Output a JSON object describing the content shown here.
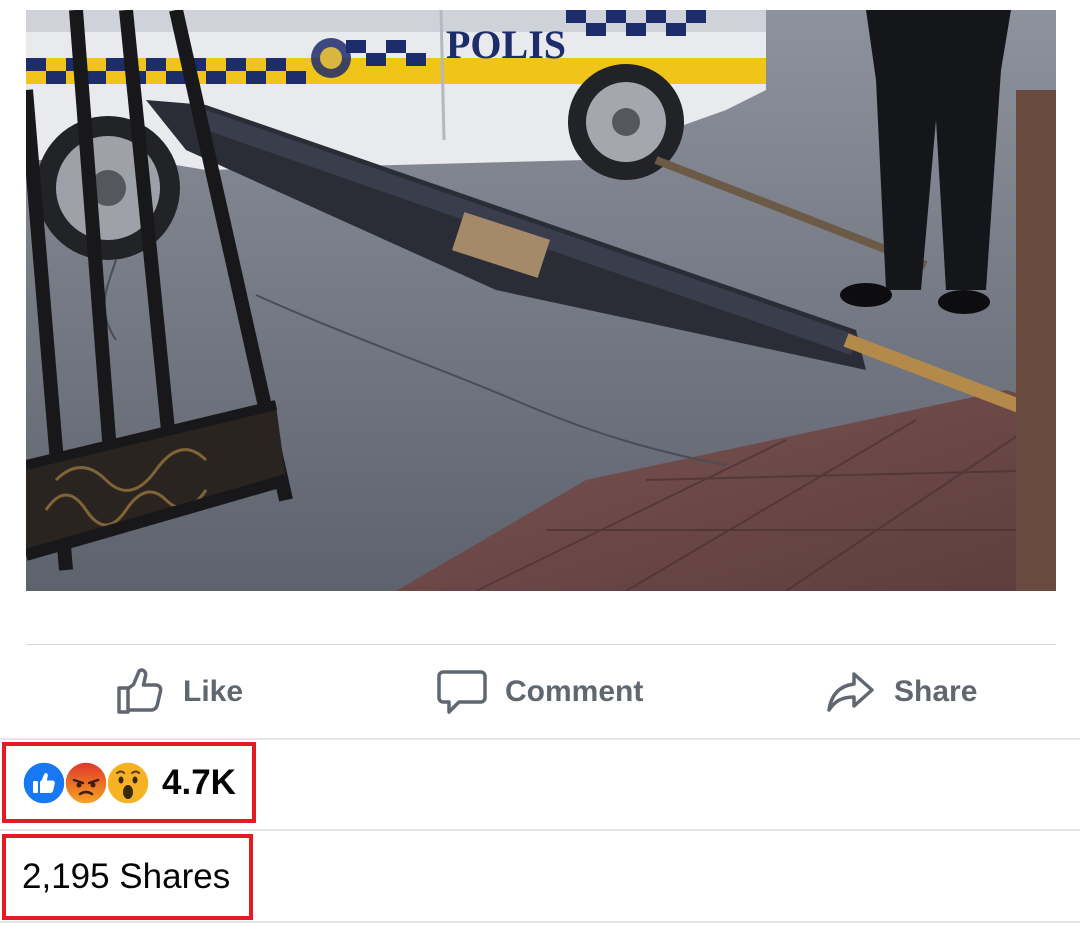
{
  "post": {
    "photo": {
      "car_label": "POLIS"
    }
  },
  "actions": {
    "like_label": "Like",
    "comment_label": "Comment",
    "share_label": "Share"
  },
  "reactions": {
    "icons": [
      "like-reaction-icon",
      "angry-reaction-icon",
      "wow-reaction-icon"
    ],
    "count": "4.7K"
  },
  "shares": {
    "text": "2,195 Shares"
  },
  "colors": {
    "highlight_border": "#e31b23",
    "action_text": "#606770",
    "like_blue": "#1877f2",
    "angry_orange": "#e9710f",
    "wow_yellow": "#f7b125"
  }
}
